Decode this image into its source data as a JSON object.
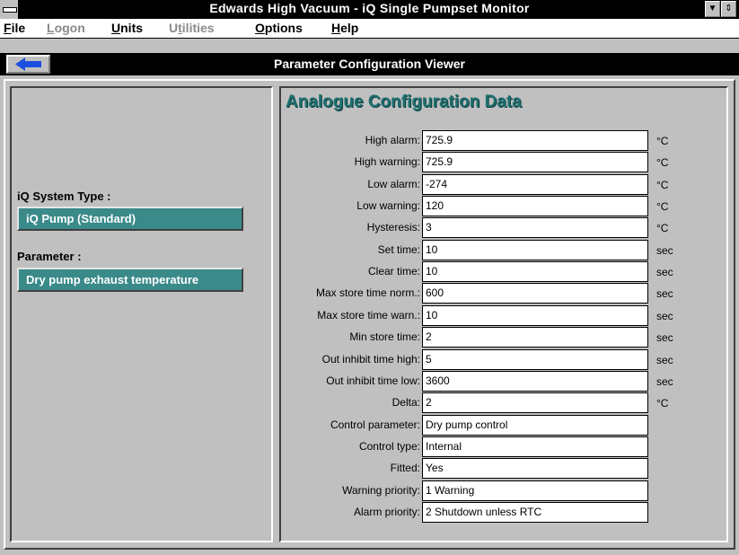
{
  "window": {
    "title": "Edwards High Vacuum - iQ  Single  Pumpset Monitor"
  },
  "menu": [
    {
      "label": "File",
      "accel": "F",
      "rest": "ile",
      "enabled": true
    },
    {
      "label": "Logon",
      "accel": "L",
      "rest": "ogon",
      "enabled": false
    },
    {
      "label": "Units",
      "accel": "U",
      "rest": "nits",
      "enabled": true
    },
    {
      "label": "Utilities",
      "accel": "t",
      "pre": "U",
      "rest": "ilities",
      "enabled": false
    },
    {
      "label": "Options",
      "accel": "O",
      "rest": "ptions",
      "enabled": true
    },
    {
      "label": "Help",
      "accel": "H",
      "rest": "elp",
      "enabled": true
    }
  ],
  "viewer": {
    "title": "Parameter Configuration Viewer",
    "back_icon": "left-arrow-icon"
  },
  "left": {
    "system_type_label": "iQ System Type :",
    "system_type_value": "iQ Pump (Standard)",
    "parameter_label": "Parameter :",
    "parameter_value": "Dry pump exhaust temperature"
  },
  "config": {
    "title": "Analogue Configuration Data",
    "rows": [
      {
        "label": "High alarm:",
        "value": "725.9",
        "unit": "°C"
      },
      {
        "label": "High warning:",
        "value": "725.9",
        "unit": "°C"
      },
      {
        "label": "Low alarm:",
        "value": "-274",
        "unit": "°C"
      },
      {
        "label": "Low warning:",
        "value": "120",
        "unit": "°C"
      },
      {
        "label": "Hysteresis:",
        "value": "3",
        "unit": "°C"
      },
      {
        "label": "Set time:",
        "value": "10",
        "unit": "sec"
      },
      {
        "label": "Clear time:",
        "value": "10",
        "unit": "sec"
      },
      {
        "label": "Max store time norm.:",
        "value": "600",
        "unit": "sec"
      },
      {
        "label": "Max store time warn.:",
        "value": "10",
        "unit": "sec"
      },
      {
        "label": "Min store time:",
        "value": "2",
        "unit": "sec"
      },
      {
        "label": "Out inhibit time high:",
        "value": "5",
        "unit": "sec"
      },
      {
        "label": "Out inhibit time low:",
        "value": "3600",
        "unit": "sec"
      },
      {
        "label": "Delta:",
        "value": "2",
        "unit": "°C"
      },
      {
        "label": "Control parameter:",
        "value": "Dry pump control",
        "unit": ""
      },
      {
        "label": "Control type:",
        "value": "Internal",
        "unit": ""
      },
      {
        "label": "Fitted:",
        "value": "Yes",
        "unit": ""
      },
      {
        "label": "Warning priority:",
        "value": "1 Warning",
        "unit": ""
      },
      {
        "label": "Alarm priority:",
        "value": "2 Shutdown unless RTC",
        "unit": ""
      }
    ]
  }
}
